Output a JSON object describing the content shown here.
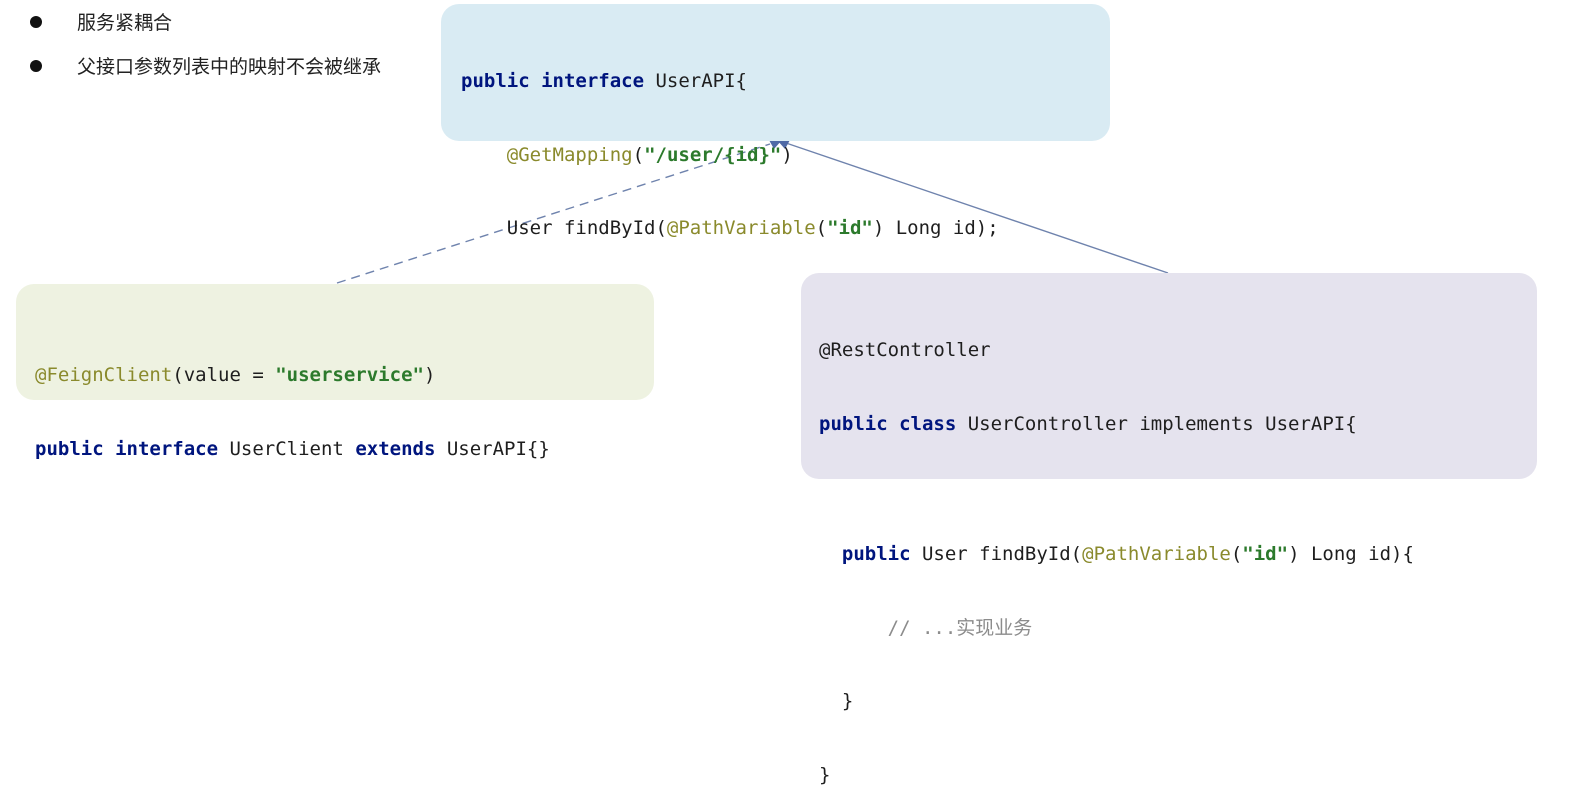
{
  "bullets": [
    "服务紧耦合",
    "父接口参数列表中的映射不会被继承"
  ],
  "api_code": {
    "l1": {
      "k1": "public",
      "k2": "interface",
      "t": " UserAPI{"
    },
    "l2": {
      "ann": "@GetMapping",
      "p1": "(",
      "str": "\"/user/{id}\"",
      "p2": ")"
    },
    "l3": {
      "t1": "User findById(",
      "ann": "@PathVariable",
      "p1": "(",
      "str": "\"id\"",
      "t2": ") Long id);"
    },
    "l4": "}"
  },
  "feign_code": {
    "l1": {
      "ann": "@FeignClient",
      "t1": "(value = ",
      "str": "\"userservice\"",
      "t2": ")"
    },
    "l2": {
      "k1": "public",
      "k2": "interface",
      "t1": " UserClient ",
      "k3": "extends",
      "t2": " UserAPI{}"
    }
  },
  "ctrl_code": {
    "l1": "@RestController",
    "l2": {
      "k1": "public",
      "k2": "class",
      "t": " UserController implements UserAPI{"
    },
    "l3": {
      "k1": "public",
      "t1": " User findById(",
      "ann": "@PathVariable",
      "p1": "(",
      "str": "\"id\"",
      "t2": ") Long id){"
    },
    "l4": "// ...实现业务",
    "l5": "}",
    "l6": "}"
  },
  "colors": {
    "api_box": "#d9ebf3",
    "feign_box": "#eef2e1",
    "controller_box": "#e5e3ee",
    "keyword": "#00157e",
    "annotation": "#8a8a2c",
    "string": "#2c7a2c",
    "comment": "#8c8c8c",
    "arrow": "#6f83ad"
  }
}
